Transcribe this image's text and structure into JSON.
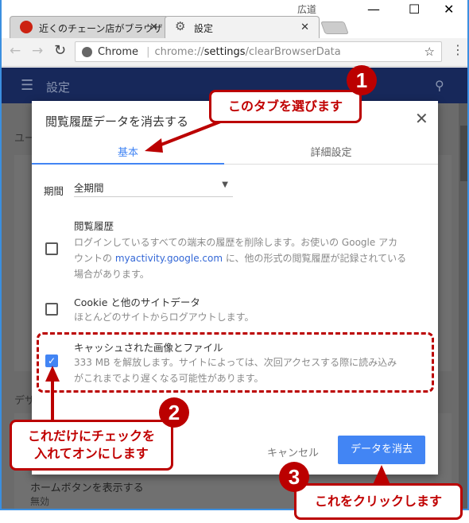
{
  "browser": {
    "user_name": "広道",
    "tabs": [
      {
        "title": "近くのチェーン店がブラウザで",
        "icon": "bird-favicon"
      },
      {
        "title": "設定",
        "icon": "gear-icon"
      }
    ],
    "omnibox": {
      "site_label": "Chrome",
      "url_host": "chrome://",
      "url_path_bold": "settings",
      "url_rest": "/clearBrowserData"
    }
  },
  "settings": {
    "header_title": "設定",
    "bg_labels": [
      "ユー",
      "デザ"
    ],
    "home_button_label": "ホームボタンを表示する",
    "home_button_value": "無効"
  },
  "dialog": {
    "title": "閲覧履歴データを消去する",
    "tabs": [
      {
        "label": "基本",
        "active": true
      },
      {
        "label": "詳細設定",
        "active": false
      }
    ],
    "period_label": "期間",
    "period_value": "全期間",
    "items": [
      {
        "title": "閲覧履歴",
        "desc1": "ログインしているすべての端末の履歴を削除します。お使いの Google アカ",
        "desc2a": "ウントの ",
        "link": "myactivity.google.com",
        "desc2b": " に、他の形式の閲覧履歴が記録されている",
        "desc3": "場合があります。",
        "checked": false
      },
      {
        "title": "Cookie と他のサイトデータ",
        "desc1": "ほとんどのサイトからログアウトします。",
        "checked": false
      },
      {
        "title": "キャッシュされた画像とファイル",
        "desc1": "333 MB を解放します。サイトによっては、次回アクセスする際に読み込み",
        "desc2": "がこれまでより遅くなる可能性があります。",
        "checked": true
      }
    ],
    "cancel_label": "キャンセル",
    "clear_label": "データを消去"
  },
  "annotations": [
    {
      "number": "1",
      "text": "このタブを選びます"
    },
    {
      "number": "2",
      "line1": "これだけにチェックを",
      "line2": "入れてオンにします"
    },
    {
      "number": "3",
      "text": "これをクリックします"
    }
  ],
  "colors": {
    "accent": "#4285f4",
    "annotation": "#b00000",
    "header": "#17285a"
  }
}
